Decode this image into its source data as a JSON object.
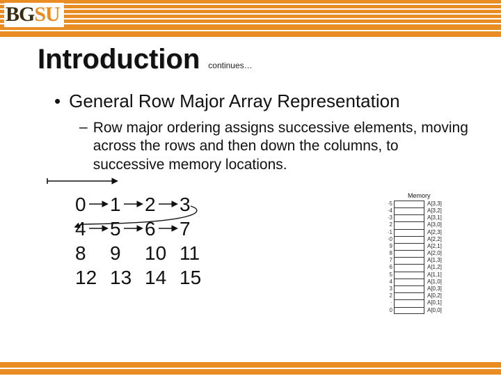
{
  "logo": {
    "part1": "BG",
    "part2": "SU"
  },
  "title": "Introduction",
  "continues": "continues…",
  "bullet": "General Row Major Array Representation",
  "subbullet": "Row major ordering assigns successive elements, moving across the rows and then down the columns, to successive memory locations.",
  "matrix": [
    [
      "0",
      "1",
      "2",
      "3"
    ],
    [
      "4",
      "5",
      "6",
      "7"
    ],
    [
      "8",
      "9",
      "10",
      "11"
    ],
    [
      "12",
      "13",
      "14",
      "15"
    ]
  ],
  "memory": {
    "title": "Memory",
    "rows": [
      {
        "idx": "·5",
        "label": "A[3,3]"
      },
      {
        "idx": "·4",
        "label": "A[3,2]"
      },
      {
        "idx": "·3",
        "label": "A[3,1]"
      },
      {
        "idx": "2",
        "label": "A[3,0]"
      },
      {
        "idx": "·1",
        "label": "A[2,3]"
      },
      {
        "idx": "·0",
        "label": "A[2,2]"
      },
      {
        "idx": "9",
        "label": "A[2,1]"
      },
      {
        "idx": "8",
        "label": "A[2,0]"
      },
      {
        "idx": "7",
        "label": "A[1,3]"
      },
      {
        "idx": "6",
        "label": "A[1,2]"
      },
      {
        "idx": "5",
        "label": "A[1,1]"
      },
      {
        "idx": "4",
        "label": "A[1,0]"
      },
      {
        "idx": "3",
        "label": "A[0,3]"
      },
      {
        "idx": "2",
        "label": "A[0,2]"
      },
      {
        "idx": "·",
        "label": "A[0,1]"
      },
      {
        "idx": "0",
        "label": "A[0,0]"
      }
    ]
  }
}
